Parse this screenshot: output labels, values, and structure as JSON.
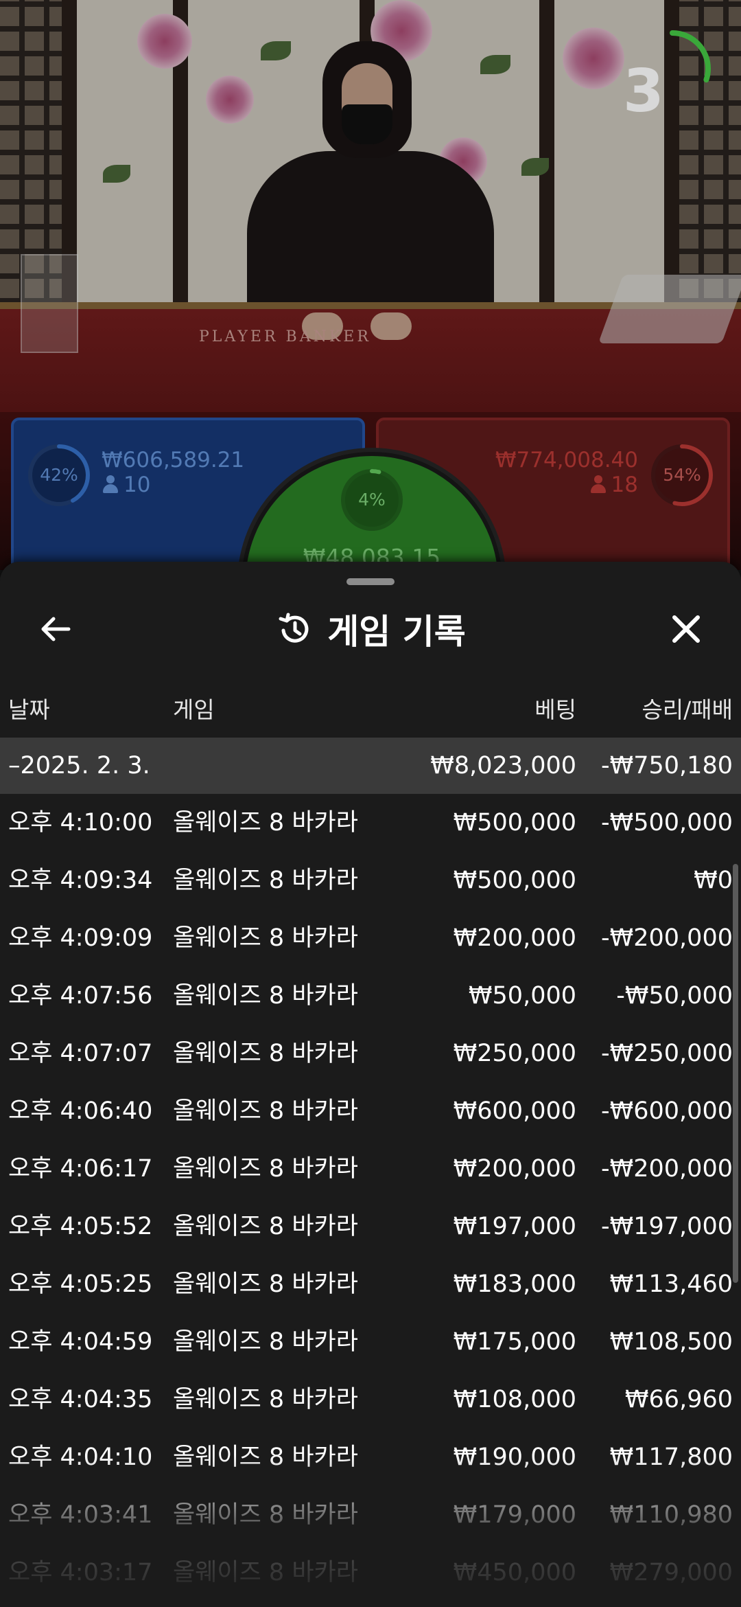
{
  "video": {
    "felt_text": "PLAYER     BANKER",
    "countdown": "3",
    "countdown_progress": 0.3
  },
  "player_panel": {
    "percent": "42%",
    "percent_value": 0.42,
    "amount": "₩606,589.21",
    "players": "10",
    "color": "#2c5fb8"
  },
  "banker_panel": {
    "percent": "54%",
    "percent_value": 0.54,
    "amount": "₩774,008.40",
    "players": "18",
    "color": "#c9302c"
  },
  "tie_panel": {
    "percent": "4%",
    "percent_value": 0.04,
    "amount": "₩48,083.15",
    "color": "#2f8f2a"
  },
  "sheet": {
    "title": "게임 기록",
    "back_icon": "arrow-left-icon",
    "close_icon": "close-icon",
    "history_icon": "history-icon",
    "columns": {
      "date": "날짜",
      "game": "게임",
      "bet": "베팅",
      "result": "승리/패배"
    },
    "date_group": {
      "date": "–2025. 2. 3.",
      "bet": "₩8,023,000",
      "result": "-₩750,180"
    },
    "rows": [
      {
        "time": "오후 4:10:00",
        "game": "올웨이즈 8 바카라",
        "bet": "₩500,000",
        "result": "-₩500,000"
      },
      {
        "time": "오후 4:09:34",
        "game": "올웨이즈 8 바카라",
        "bet": "₩500,000",
        "result": "₩0"
      },
      {
        "time": "오후 4:09:09",
        "game": "올웨이즈 8 바카라",
        "bet": "₩200,000",
        "result": "-₩200,000"
      },
      {
        "time": "오후 4:07:56",
        "game": "올웨이즈 8 바카라",
        "bet": "₩50,000",
        "result": "-₩50,000"
      },
      {
        "time": "오후 4:07:07",
        "game": "올웨이즈 8 바카라",
        "bet": "₩250,000",
        "result": "-₩250,000"
      },
      {
        "time": "오후 4:06:40",
        "game": "올웨이즈 8 바카라",
        "bet": "₩600,000",
        "result": "-₩600,000"
      },
      {
        "time": "오후 4:06:17",
        "game": "올웨이즈 8 바카라",
        "bet": "₩200,000",
        "result": "-₩200,000"
      },
      {
        "time": "오후 4:05:52",
        "game": "올웨이즈 8 바카라",
        "bet": "₩197,000",
        "result": "-₩197,000"
      },
      {
        "time": "오후 4:05:25",
        "game": "올웨이즈 8 바카라",
        "bet": "₩183,000",
        "result": "₩113,460"
      },
      {
        "time": "오후 4:04:59",
        "game": "올웨이즈 8 바카라",
        "bet": "₩175,000",
        "result": "₩108,500"
      },
      {
        "time": "오후 4:04:35",
        "game": "올웨이즈 8 바카라",
        "bet": "₩108,000",
        "result": "₩66,960"
      },
      {
        "time": "오후 4:04:10",
        "game": "올웨이즈 8 바카라",
        "bet": "₩190,000",
        "result": "₩117,800"
      },
      {
        "time": "오후 4:03:41",
        "game": "올웨이즈 8 바카라",
        "bet": "₩179,000",
        "result": "₩110,980"
      },
      {
        "time": "오후 4:03:17",
        "game": "올웨이즈 8 바카라",
        "bet": "₩450,000",
        "result": "₩279,000"
      }
    ]
  }
}
